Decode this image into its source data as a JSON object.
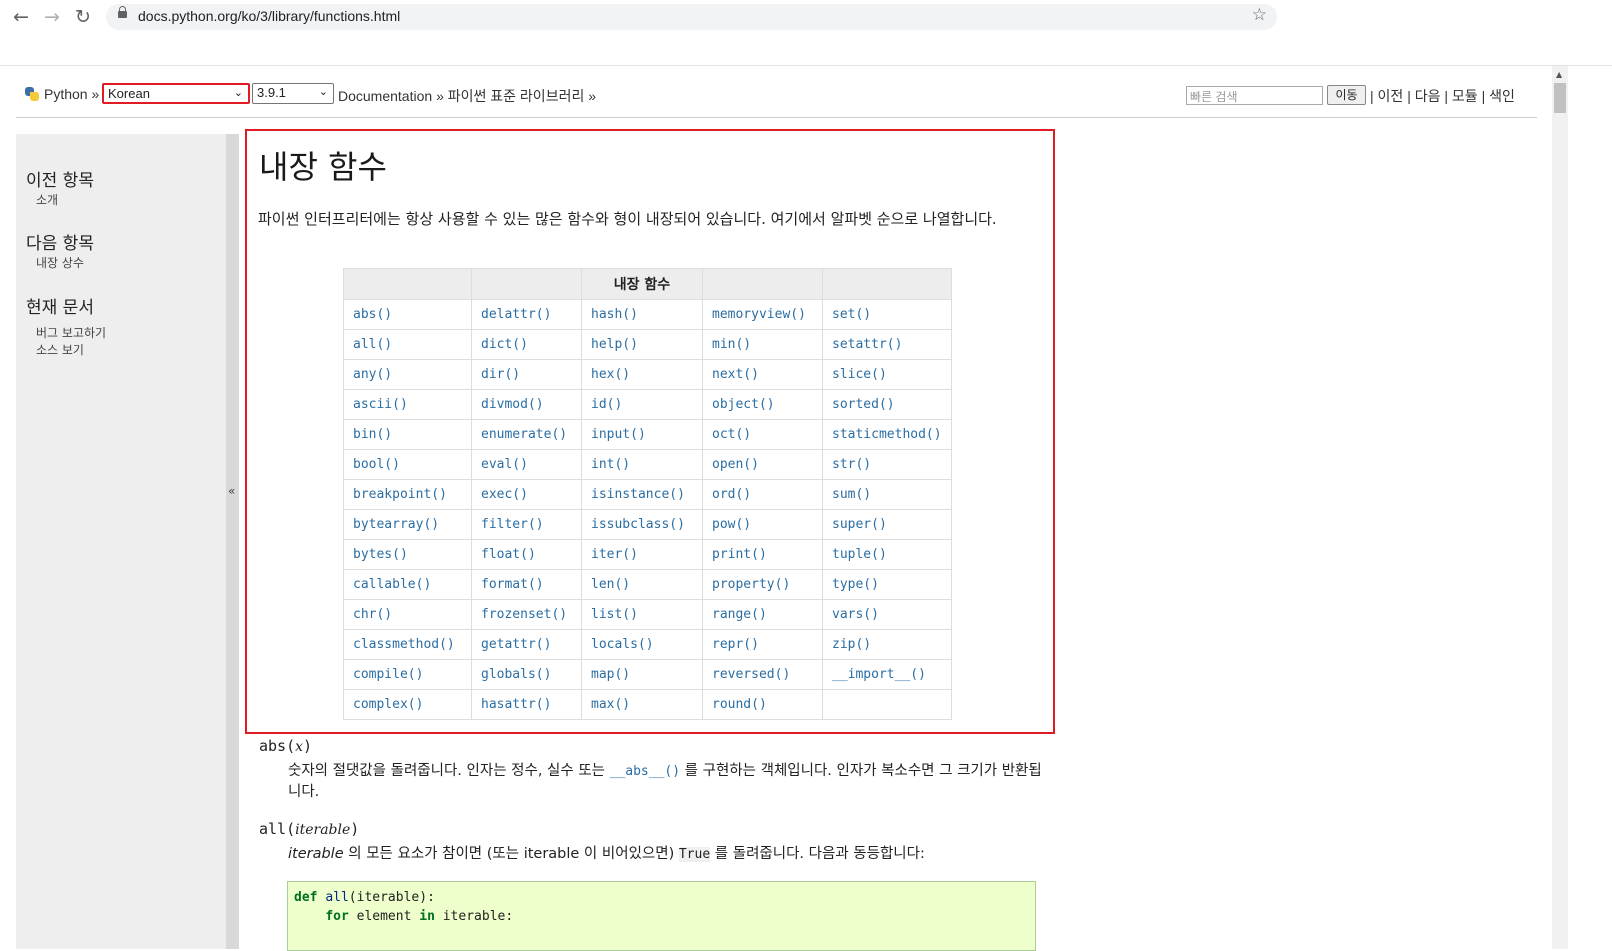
{
  "browser": {
    "url": "docs.python.org/ko/3/library/functions.html",
    "back_icon": "←",
    "forward_icon": "→",
    "reload_icon": "↻",
    "star_icon": "☆"
  },
  "relbar": {
    "python": "Python",
    "sep": "»",
    "language": "Korean",
    "version": "3.9.1",
    "documentation": "Documentation",
    "stdlib": "파이썬 표준 라이브러리",
    "search_placeholder": "빠른 검색",
    "go_label": "이동",
    "prev": "이전",
    "next": "다음",
    "modules": "모듈",
    "index": "색인",
    "pipe": "|"
  },
  "sidebar": {
    "prev_heading": "이전 항목",
    "prev_link": "소개",
    "next_heading": "다음 항목",
    "next_link": "내장 상수",
    "this_page_heading": "현재 문서",
    "bug_report": "버그 보고하기",
    "show_source": "소스 보기",
    "collapse": "«"
  },
  "main": {
    "title": "내장 함수",
    "intro": "파이썬 인터프리터에는 항상 사용할 수 있는 많은 함수와 형이 내장되어 있습니다. 여기에서 알파벳 순으로 나열합니다.",
    "table_header": "내장 함수",
    "columns": [
      [
        "abs()",
        "all()",
        "any()",
        "ascii()",
        "bin()",
        "bool()",
        "breakpoint()",
        "bytearray()",
        "bytes()",
        "callable()",
        "chr()",
        "classmethod()",
        "compile()",
        "complex()"
      ],
      [
        "delattr()",
        "dict()",
        "dir()",
        "divmod()",
        "enumerate()",
        "eval()",
        "exec()",
        "filter()",
        "float()",
        "format()",
        "frozenset()",
        "getattr()",
        "globals()",
        "hasattr()"
      ],
      [
        "hash()",
        "help()",
        "hex()",
        "id()",
        "input()",
        "int()",
        "isinstance()",
        "issubclass()",
        "iter()",
        "len()",
        "list()",
        "locals()",
        "map()",
        "max()"
      ],
      [
        "memoryview()",
        "min()",
        "next()",
        "object()",
        "oct()",
        "open()",
        "ord()",
        "pow()",
        "print()",
        "property()",
        "range()",
        "repr()",
        "reversed()",
        "round()"
      ],
      [
        "set()",
        "setattr()",
        "slice()",
        "sorted()",
        "staticmethod()",
        "str()",
        "sum()",
        "super()",
        "tuple()",
        "type()",
        "vars()",
        "zip()",
        "__import__()",
        ""
      ]
    ],
    "abs": {
      "name": "abs",
      "param": "x",
      "desc_a": "숫자의 절댓값을 돌려줍니다. 인자는 정수, 실수 또는 ",
      "desc_code": "__abs__()",
      "desc_b": " 를 구현하는 객체입니다. 인자가 복소수면 그 크기가 반환됩니다."
    },
    "all": {
      "name": "all",
      "param": "iterable",
      "desc_a": "iterable",
      "desc_b": " 의 모든 요소가 참이면 (또는 iterable 이 비어있으면) ",
      "desc_code": "True",
      "desc_c": " 를 돌려줍니다. 다음과 동등합니다:"
    },
    "code": {
      "l1_kw": "def",
      "l1_fn": "all",
      "l1_rest": "(iterable):",
      "l2_kw": "for",
      "l2_a": " element ",
      "l2_kw2": "in",
      "l2_b": " iterable:"
    }
  }
}
